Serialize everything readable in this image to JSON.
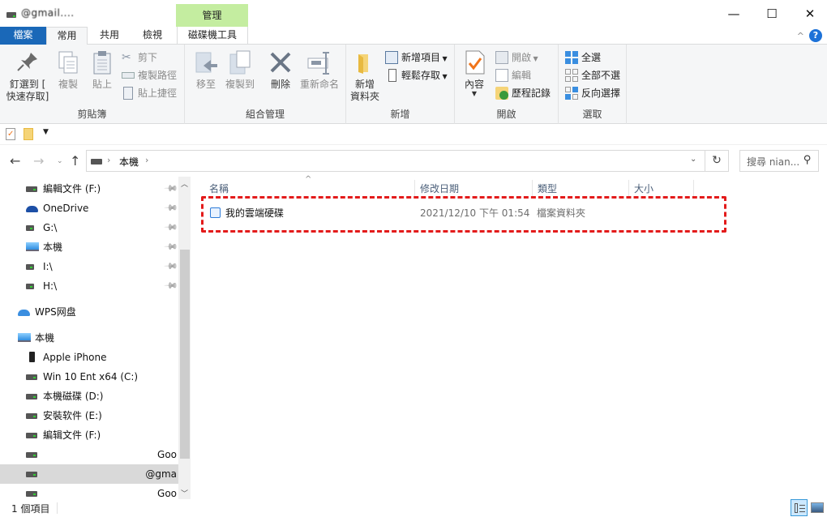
{
  "window": {
    "title": "@gmail....",
    "context_tab_group": "管理",
    "controls": {
      "minimize": "—",
      "maximize": "☐",
      "close": "✕"
    }
  },
  "ribbon_tabs": {
    "file": "檔案",
    "home": "常用",
    "share": "共用",
    "view": "檢視",
    "drive_tools": "磁碟機工具",
    "collapse_icon": "^",
    "help_icon": "?"
  },
  "ribbon": {
    "clipboard": {
      "label": "剪貼簿",
      "pin_quick_access": [
        "釘選到 [",
        "快速存取]"
      ],
      "copy": "複製",
      "paste": "貼上",
      "cut": "剪下",
      "copy_path": "複製路徑",
      "paste_shortcut": "貼上捷徑"
    },
    "organize": {
      "label": "組合管理",
      "move_to": "移至",
      "copy_to": "複製到",
      "delete": "刪除",
      "rename": "重新命名"
    },
    "new": {
      "label": "新增",
      "new_folder": [
        "新增",
        "資料夾"
      ],
      "new_item": "新增項目",
      "easy_access": "輕鬆存取"
    },
    "open": {
      "label": "開啟",
      "properties": "內容",
      "open": "開啟",
      "edit": "編輯",
      "history": "歷程記錄"
    },
    "select": {
      "label": "選取",
      "select_all": "全選",
      "select_none": "全部不選",
      "invert_selection": "反向選擇"
    }
  },
  "address_bar": {
    "breadcrumb": [
      "本機",
      ""
    ],
    "search_placeholder": "搜尋 nian..."
  },
  "sidebar": {
    "items": [
      {
        "label": "編輯文件 (F:)",
        "icon": "drive-icon",
        "pinned": true
      },
      {
        "label": "OneDrive",
        "icon": "onedrive-icon",
        "pinned": true
      },
      {
        "label": "G:\\",
        "icon": "unknown-drive-icon",
        "pinned": true
      },
      {
        "label": "本機",
        "icon": "computer-icon",
        "pinned": true
      },
      {
        "label": "I:\\",
        "icon": "unknown-drive-icon",
        "pinned": true
      },
      {
        "label": "H:\\",
        "icon": "unknown-drive-icon",
        "pinned": true
      },
      {
        "label": "WPS网盘",
        "icon": "cloud-icon",
        "pinned": false
      },
      {
        "label": "本機",
        "icon": "computer-icon",
        "pinned": false
      },
      {
        "label": "Apple iPhone",
        "icon": "phone-icon",
        "pinned": false
      },
      {
        "label": "Win 10 Ent x64 (C:)",
        "icon": "windows-drive-icon",
        "pinned": false
      },
      {
        "label": "本機磁碟 (D:)",
        "icon": "drive-icon",
        "pinned": false
      },
      {
        "label": "安裝软件 (E:)",
        "icon": "drive-icon",
        "pinned": false
      },
      {
        "label": "編辑文件 (F:)",
        "icon": "drive-icon",
        "pinned": false
      },
      {
        "label": "Goo",
        "icon": "drive-icon",
        "pinned": false
      },
      {
        "label": "@gma",
        "icon": "drive-icon",
        "pinned": false,
        "selected": true
      },
      {
        "label": "Goo",
        "icon": "drive-icon",
        "pinned": false
      }
    ]
  },
  "file_list": {
    "columns": [
      "名稱",
      "修改日期",
      "類型",
      "大小"
    ],
    "rows": [
      {
        "name": "我的雲端硬碟",
        "modified": "2021/12/10 下午 01:54",
        "type": "檔案資料夾",
        "size": ""
      }
    ]
  },
  "status_bar": {
    "item_count": "1 個項目"
  },
  "colors": {
    "file_tab": "#1a68b8",
    "manage_tab": "#c4eda0",
    "highlight_border": "#e31b1b",
    "column_header_text": "#4c607a"
  }
}
